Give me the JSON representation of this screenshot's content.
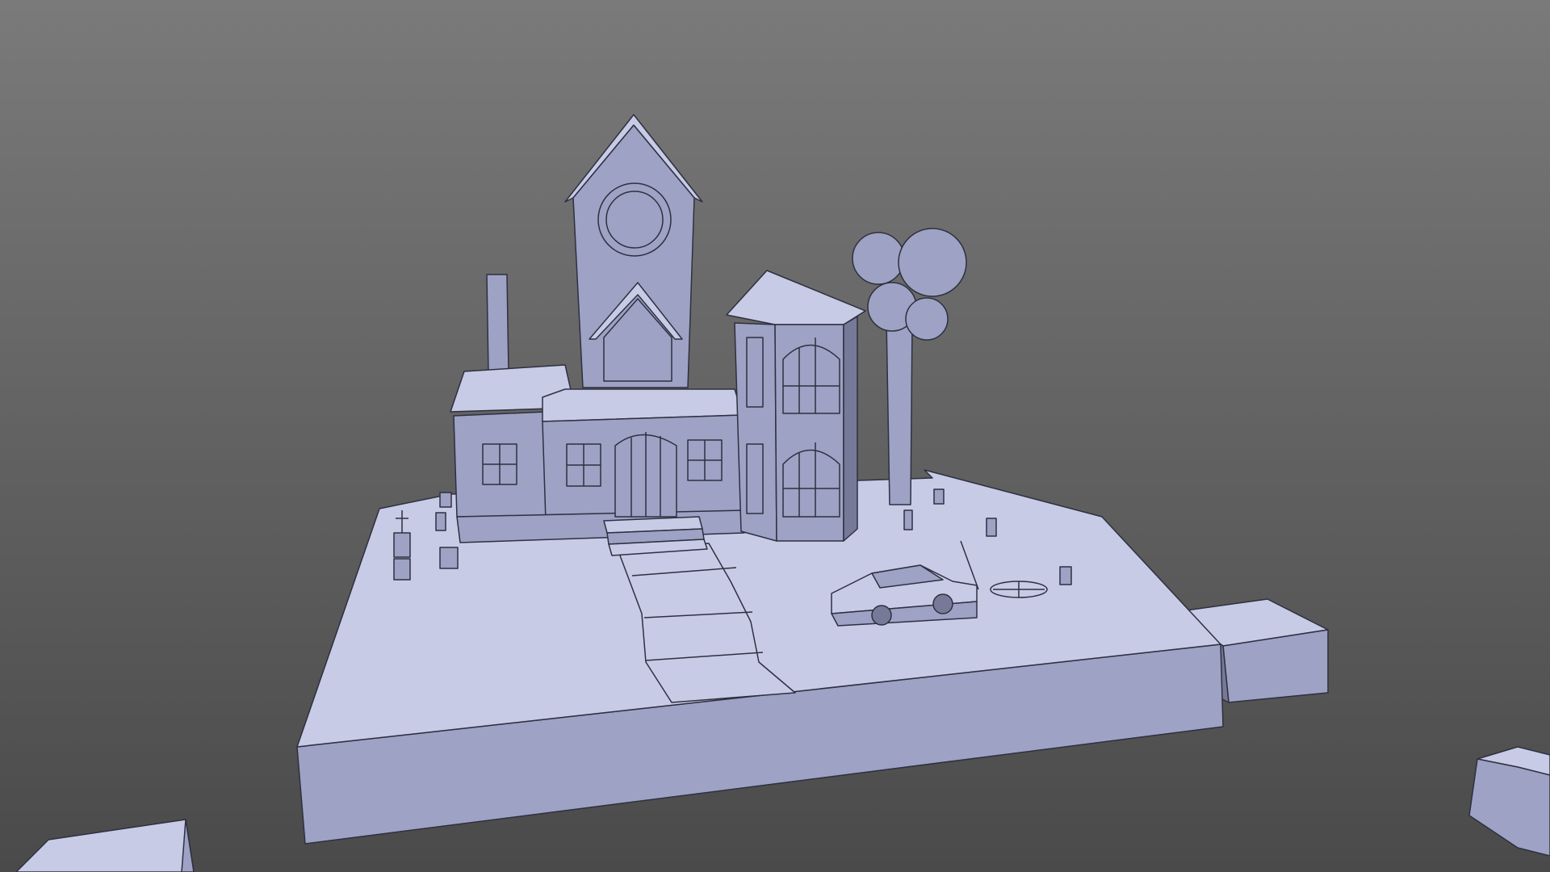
{
  "scene": {
    "background_top": "#7a7a7a",
    "background_bottom": "#4a4a4a",
    "model_light": "#c8cbe6",
    "model_mid": "#9ea2c4",
    "model_dark": "#767a98",
    "edge_color": "#2e3040"
  }
}
